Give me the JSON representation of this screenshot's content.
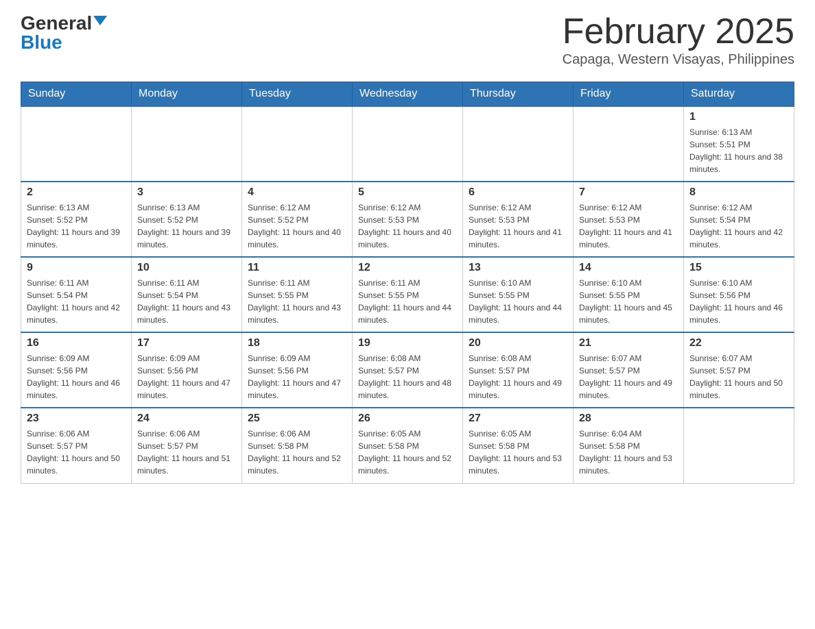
{
  "logo": {
    "general": "General",
    "blue": "Blue"
  },
  "title": {
    "month_year": "February 2025",
    "location": "Capaga, Western Visayas, Philippines"
  },
  "weekdays": [
    "Sunday",
    "Monday",
    "Tuesday",
    "Wednesday",
    "Thursday",
    "Friday",
    "Saturday"
  ],
  "weeks": [
    [
      {
        "day": "",
        "empty": true
      },
      {
        "day": "",
        "empty": true
      },
      {
        "day": "",
        "empty": true
      },
      {
        "day": "",
        "empty": true
      },
      {
        "day": "",
        "empty": true
      },
      {
        "day": "",
        "empty": true
      },
      {
        "day": "1",
        "sunrise": "Sunrise: 6:13 AM",
        "sunset": "Sunset: 5:51 PM",
        "daylight": "Daylight: 11 hours and 38 minutes."
      }
    ],
    [
      {
        "day": "2",
        "sunrise": "Sunrise: 6:13 AM",
        "sunset": "Sunset: 5:52 PM",
        "daylight": "Daylight: 11 hours and 39 minutes."
      },
      {
        "day": "3",
        "sunrise": "Sunrise: 6:13 AM",
        "sunset": "Sunset: 5:52 PM",
        "daylight": "Daylight: 11 hours and 39 minutes."
      },
      {
        "day": "4",
        "sunrise": "Sunrise: 6:12 AM",
        "sunset": "Sunset: 5:52 PM",
        "daylight": "Daylight: 11 hours and 40 minutes."
      },
      {
        "day": "5",
        "sunrise": "Sunrise: 6:12 AM",
        "sunset": "Sunset: 5:53 PM",
        "daylight": "Daylight: 11 hours and 40 minutes."
      },
      {
        "day": "6",
        "sunrise": "Sunrise: 6:12 AM",
        "sunset": "Sunset: 5:53 PM",
        "daylight": "Daylight: 11 hours and 41 minutes."
      },
      {
        "day": "7",
        "sunrise": "Sunrise: 6:12 AM",
        "sunset": "Sunset: 5:53 PM",
        "daylight": "Daylight: 11 hours and 41 minutes."
      },
      {
        "day": "8",
        "sunrise": "Sunrise: 6:12 AM",
        "sunset": "Sunset: 5:54 PM",
        "daylight": "Daylight: 11 hours and 42 minutes."
      }
    ],
    [
      {
        "day": "9",
        "sunrise": "Sunrise: 6:11 AM",
        "sunset": "Sunset: 5:54 PM",
        "daylight": "Daylight: 11 hours and 42 minutes."
      },
      {
        "day": "10",
        "sunrise": "Sunrise: 6:11 AM",
        "sunset": "Sunset: 5:54 PM",
        "daylight": "Daylight: 11 hours and 43 minutes."
      },
      {
        "day": "11",
        "sunrise": "Sunrise: 6:11 AM",
        "sunset": "Sunset: 5:55 PM",
        "daylight": "Daylight: 11 hours and 43 minutes."
      },
      {
        "day": "12",
        "sunrise": "Sunrise: 6:11 AM",
        "sunset": "Sunset: 5:55 PM",
        "daylight": "Daylight: 11 hours and 44 minutes."
      },
      {
        "day": "13",
        "sunrise": "Sunrise: 6:10 AM",
        "sunset": "Sunset: 5:55 PM",
        "daylight": "Daylight: 11 hours and 44 minutes."
      },
      {
        "day": "14",
        "sunrise": "Sunrise: 6:10 AM",
        "sunset": "Sunset: 5:55 PM",
        "daylight": "Daylight: 11 hours and 45 minutes."
      },
      {
        "day": "15",
        "sunrise": "Sunrise: 6:10 AM",
        "sunset": "Sunset: 5:56 PM",
        "daylight": "Daylight: 11 hours and 46 minutes."
      }
    ],
    [
      {
        "day": "16",
        "sunrise": "Sunrise: 6:09 AM",
        "sunset": "Sunset: 5:56 PM",
        "daylight": "Daylight: 11 hours and 46 minutes."
      },
      {
        "day": "17",
        "sunrise": "Sunrise: 6:09 AM",
        "sunset": "Sunset: 5:56 PM",
        "daylight": "Daylight: 11 hours and 47 minutes."
      },
      {
        "day": "18",
        "sunrise": "Sunrise: 6:09 AM",
        "sunset": "Sunset: 5:56 PM",
        "daylight": "Daylight: 11 hours and 47 minutes."
      },
      {
        "day": "19",
        "sunrise": "Sunrise: 6:08 AM",
        "sunset": "Sunset: 5:57 PM",
        "daylight": "Daylight: 11 hours and 48 minutes."
      },
      {
        "day": "20",
        "sunrise": "Sunrise: 6:08 AM",
        "sunset": "Sunset: 5:57 PM",
        "daylight": "Daylight: 11 hours and 49 minutes."
      },
      {
        "day": "21",
        "sunrise": "Sunrise: 6:07 AM",
        "sunset": "Sunset: 5:57 PM",
        "daylight": "Daylight: 11 hours and 49 minutes."
      },
      {
        "day": "22",
        "sunrise": "Sunrise: 6:07 AM",
        "sunset": "Sunset: 5:57 PM",
        "daylight": "Daylight: 11 hours and 50 minutes."
      }
    ],
    [
      {
        "day": "23",
        "sunrise": "Sunrise: 6:06 AM",
        "sunset": "Sunset: 5:57 PM",
        "daylight": "Daylight: 11 hours and 50 minutes."
      },
      {
        "day": "24",
        "sunrise": "Sunrise: 6:06 AM",
        "sunset": "Sunset: 5:57 PM",
        "daylight": "Daylight: 11 hours and 51 minutes."
      },
      {
        "day": "25",
        "sunrise": "Sunrise: 6:06 AM",
        "sunset": "Sunset: 5:58 PM",
        "daylight": "Daylight: 11 hours and 52 minutes."
      },
      {
        "day": "26",
        "sunrise": "Sunrise: 6:05 AM",
        "sunset": "Sunset: 5:58 PM",
        "daylight": "Daylight: 11 hours and 52 minutes."
      },
      {
        "day": "27",
        "sunrise": "Sunrise: 6:05 AM",
        "sunset": "Sunset: 5:58 PM",
        "daylight": "Daylight: 11 hours and 53 minutes."
      },
      {
        "day": "28",
        "sunrise": "Sunrise: 6:04 AM",
        "sunset": "Sunset: 5:58 PM",
        "daylight": "Daylight: 11 hours and 53 minutes."
      },
      {
        "day": "",
        "empty": true
      }
    ]
  ]
}
